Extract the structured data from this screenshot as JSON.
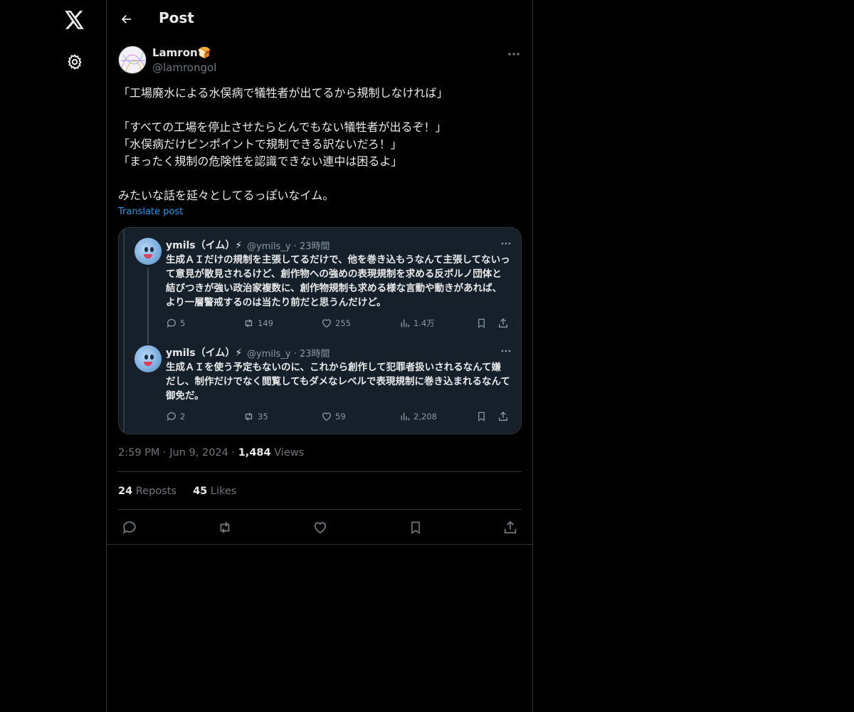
{
  "header": {
    "title": "Post"
  },
  "post": {
    "author_name": "Lamron🍞",
    "author_handle": "@lamrongol",
    "text": "「工場廃水による水俣病で犠牲者が出てるから規制しなければ」\n\n「すべての工場を停止させたらとんでもない犠牲者が出るぞ！」\n「水俣病だけピンポイントで規制できる訳ないだろ！」\n「まったく規制の危険性を認識できない連中は困るよ」\n\nみたいな話を延々としてるっぽいなイム。",
    "translate_label": "Translate post",
    "time": "2:59 PM",
    "date": "Jun 9, 2024",
    "views_count": "1,484",
    "views_label": "Views",
    "reposts_count": "24",
    "reposts_label": "Reposts",
    "likes_count": "45",
    "likes_label": "Likes"
  },
  "embedded": {
    "tweets": [
      {
        "name": "ymils（イム）⚡",
        "meta": "@ymils_y · 23時間",
        "text": "生成ＡＩだけの規制を主張してるだけで、他を巻き込もうなんて主張してないって意見が散見されるけど、創作物への強めの表現規制を求める反ポルノ団体と結びつきが強い政治家複数に、創作物規制も求める様な言動や動きがあれば、より一層警戒するのは当たり前だと思うんだけど。",
        "replies": "5",
        "retweets": "149",
        "likes": "255",
        "views": "1.4万"
      },
      {
        "name": "ymils（イム）⚡",
        "meta": "@ymils_y · 23時間",
        "text": "生成ＡＩを使う予定もないのに、これから創作して犯罪者扱いされるなんて嫌だし、制作だけでなく閲覧してもダメなレベルで表現規制に巻き込まれるなんて御免だ。",
        "replies": "2",
        "retweets": "35",
        "likes": "59",
        "views": "2,208"
      }
    ]
  },
  "icons": {
    "logo": "x-logo-icon",
    "settings": "gear-icon",
    "back": "arrow-left-icon"
  },
  "colors": {
    "background": "#000000",
    "text": "#e7e9ea",
    "muted": "#71767b",
    "link": "#1d9bf0",
    "border": "#2f3336"
  }
}
